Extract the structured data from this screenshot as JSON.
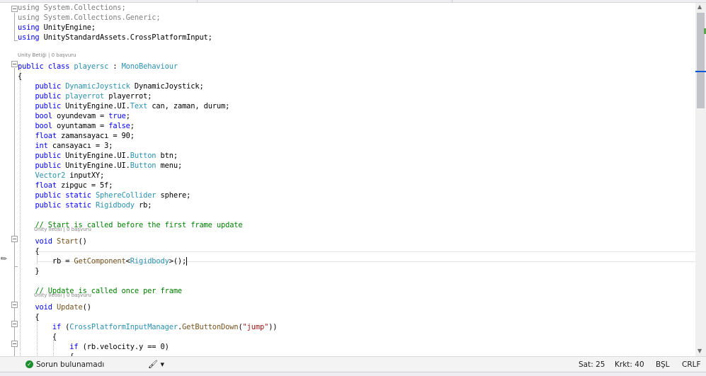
{
  "code": {
    "lines": [
      [
        [
          "dim",
          "using System.Collections;"
        ]
      ],
      [
        [
          "dim",
          "using System.Collections.Generic;"
        ]
      ],
      [
        [
          "k",
          "using"
        ],
        [
          "n",
          " UnityEngine;"
        ]
      ],
      [
        [
          "k",
          "using"
        ],
        [
          "n",
          " UnityStandardAssets.CrossPlatformInput;"
        ]
      ],
      [
        [
          "n",
          ""
        ]
      ],
      [
        [
          "k",
          "public"
        ],
        [
          "n",
          " "
        ],
        [
          "k",
          "class"
        ],
        [
          "n",
          " "
        ],
        [
          "t",
          "playersc"
        ],
        [
          "n",
          " : "
        ],
        [
          "t",
          "MonoBehaviour"
        ]
      ],
      [
        [
          "n",
          "{"
        ]
      ],
      [
        [
          "n",
          "    "
        ],
        [
          "k",
          "public"
        ],
        [
          "n",
          " "
        ],
        [
          "t",
          "DynamicJoystick"
        ],
        [
          "n",
          " DynamicJoystick;"
        ]
      ],
      [
        [
          "n",
          "    "
        ],
        [
          "k",
          "public"
        ],
        [
          "n",
          " "
        ],
        [
          "t",
          "playerrot"
        ],
        [
          "n",
          " playerrot;"
        ]
      ],
      [
        [
          "n",
          "    "
        ],
        [
          "k",
          "public"
        ],
        [
          "n",
          " UnityEngine.UI."
        ],
        [
          "t",
          "Text"
        ],
        [
          "n",
          " can, zaman, durum;"
        ]
      ],
      [
        [
          "n",
          "    "
        ],
        [
          "k",
          "bool"
        ],
        [
          "n",
          " oyundevam = "
        ],
        [
          "k",
          "true"
        ],
        [
          "n",
          ";"
        ]
      ],
      [
        [
          "n",
          "    "
        ],
        [
          "k",
          "bool"
        ],
        [
          "n",
          " oyuntamam = "
        ],
        [
          "k",
          "false"
        ],
        [
          "n",
          ";"
        ]
      ],
      [
        [
          "n",
          "    "
        ],
        [
          "k",
          "float"
        ],
        [
          "n",
          " zamansayacı = 90;"
        ]
      ],
      [
        [
          "n",
          "    "
        ],
        [
          "k",
          "int"
        ],
        [
          "n",
          " cansayacı = 3;"
        ]
      ],
      [
        [
          "n",
          "    "
        ],
        [
          "k",
          "public"
        ],
        [
          "n",
          " UnityEngine.UI."
        ],
        [
          "t",
          "Button"
        ],
        [
          "n",
          " btn;"
        ]
      ],
      [
        [
          "n",
          "    "
        ],
        [
          "k",
          "public"
        ],
        [
          "n",
          " UnityEngine.UI."
        ],
        [
          "t",
          "Button"
        ],
        [
          "n",
          " menu;"
        ]
      ],
      [
        [
          "n",
          "    "
        ],
        [
          "t",
          "Vector2"
        ],
        [
          "n",
          " inputXY;"
        ]
      ],
      [
        [
          "n",
          "    "
        ],
        [
          "k",
          "float"
        ],
        [
          "n",
          " zipguc = 5f;"
        ]
      ],
      [
        [
          "n",
          "    "
        ],
        [
          "k",
          "public"
        ],
        [
          "n",
          " "
        ],
        [
          "k",
          "static"
        ],
        [
          "n",
          " "
        ],
        [
          "t",
          "SphereCollider"
        ],
        [
          "n",
          " sphere;"
        ]
      ],
      [
        [
          "n",
          "    "
        ],
        [
          "k",
          "public"
        ],
        [
          "n",
          " "
        ],
        [
          "k",
          "static"
        ],
        [
          "n",
          " "
        ],
        [
          "t",
          "Rigidbody"
        ],
        [
          "n",
          " rb;"
        ]
      ],
      [
        [
          "n",
          ""
        ]
      ],
      [
        [
          "n",
          "    "
        ],
        [
          "c",
          "// Start is called before the first frame update"
        ]
      ],
      [
        [
          "n",
          "    "
        ],
        [
          "k",
          "void"
        ],
        [
          "n",
          " "
        ],
        [
          "f",
          "Start"
        ],
        [
          "n",
          "()"
        ]
      ],
      [
        [
          "n",
          "    {"
        ]
      ],
      [
        [
          "n",
          "        rb = "
        ],
        [
          "f",
          "GetComponent"
        ],
        [
          "n",
          "<"
        ],
        [
          "t",
          "Rigidbody"
        ],
        [
          "n",
          ">();"
        ]
      ],
      [
        [
          "n",
          "    }"
        ]
      ],
      [
        [
          "n",
          ""
        ]
      ],
      [
        [
          "n",
          "    "
        ],
        [
          "c",
          "// Update is called once per frame"
        ]
      ],
      [
        [
          "n",
          "    "
        ],
        [
          "k",
          "void"
        ],
        [
          "n",
          " "
        ],
        [
          "f",
          "Update"
        ],
        [
          "n",
          "()"
        ]
      ],
      [
        [
          "n",
          "    {"
        ]
      ],
      [
        [
          "n",
          "        "
        ],
        [
          "k",
          "if"
        ],
        [
          "n",
          " ("
        ],
        [
          "t",
          "CrossPlatformInputManager"
        ],
        [
          "n",
          "."
        ],
        [
          "f",
          "GetButtonDown"
        ],
        [
          "n",
          "("
        ],
        [
          "s",
          "\"jump\""
        ],
        [
          "n",
          "))"
        ]
      ],
      [
        [
          "n",
          "        {"
        ]
      ],
      [
        [
          "n",
          "            "
        ],
        [
          "k",
          "if"
        ],
        [
          "n",
          " (rb.velocity.y == 0)"
        ]
      ],
      [
        [
          "n",
          "            {"
        ]
      ]
    ],
    "codelens": {
      "class_refs": "Unity Betiği | 0 başvuru",
      "start_refs": "Unity İletisi | 0 başvuru",
      "update_refs": "Unity İletisi | 0 başvuru"
    }
  },
  "status": {
    "issues": "Sorun bulunamadı",
    "line": "Sat: 25",
    "column": "Krkt: 40",
    "mode": "BŞL",
    "line_ending": "CRLF"
  },
  "colors": {
    "keyword": "#0000ff",
    "type": "#2b91af",
    "comment": "#008000",
    "string": "#a31515",
    "method": "#74531f",
    "inactive": "#808080",
    "ok": "#1e8f2e",
    "scroll_caret": "#0057d8"
  },
  "icons": {
    "status_ok": "check-circle-icon",
    "brush": "brush-icon",
    "edit_mark": "pencil-icon"
  }
}
